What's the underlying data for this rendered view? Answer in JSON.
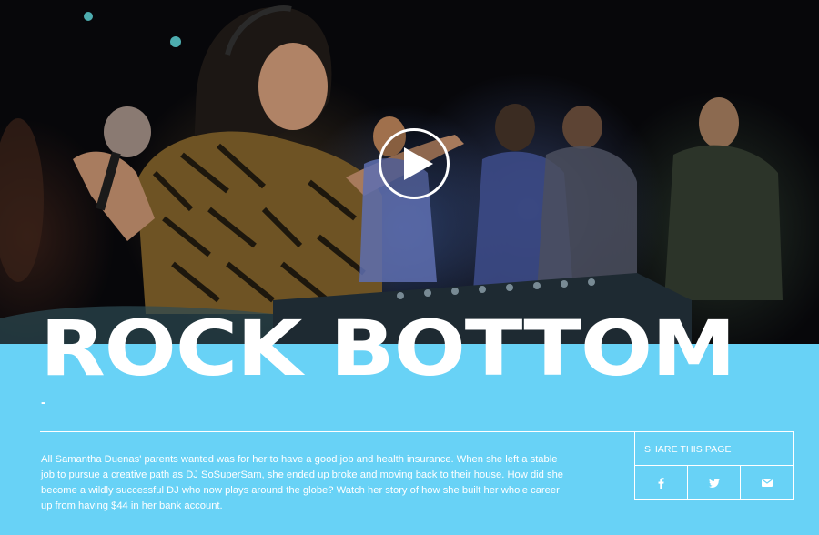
{
  "hero": {
    "play_icon": "play-icon",
    "title": "ROCK BOTTOM",
    "dash": "-"
  },
  "story": {
    "description": "All Samantha Duenas' parents wanted was for her to have a good job and health insurance. When she left a stable job to pursue a creative path as DJ SoSuperSam, she ended up broke and moving back to their house. How did she become a wildly successful DJ who now plays around the globe? Watch her story of how she built her whole career up from having $44 in her bank account."
  },
  "share": {
    "label": "SHARE THIS PAGE",
    "buttons": [
      {
        "icon": "facebook-icon"
      },
      {
        "icon": "twitter-icon"
      },
      {
        "icon": "email-icon"
      }
    ]
  },
  "colors": {
    "accent": "#68d2f6",
    "text": "#ffffff",
    "hero_bg": "#07070a"
  }
}
